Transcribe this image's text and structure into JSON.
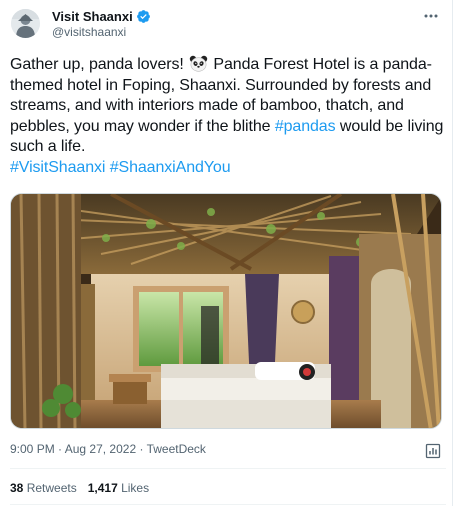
{
  "author": {
    "display_name": "Visit Shaanxi",
    "handle": "@visitshaanxi"
  },
  "tweet": {
    "text_before_link": "Gather up, panda lovers! ",
    "text_after_emoji": " Panda Forest Hotel is a panda-themed hotel in Foping, Shaanxi. Surrounded by forests and streams, and with interiors made of bamboo, thatch, and pebbles, you may wonder if the blithe ",
    "link_pandas": "#pandas",
    "text_after_link": " would be living such a life.",
    "hashtag_1": "#VisitShaanxi",
    "hashtag_2": "#ShaanxiAndYou"
  },
  "meta": {
    "time": "9:00 PM",
    "separator_1": " · ",
    "date": "Aug 27, 2022",
    "separator_2": " · ",
    "source": "TweetDeck"
  },
  "stats": {
    "retweets_count": "38",
    "retweets_label": " Retweets",
    "likes_count": "1,417",
    "likes_label": " Likes"
  },
  "colors": {
    "link": "#1d9bf0",
    "verified": "#1d9bf0",
    "secondary_text": "#536471"
  },
  "icons": {
    "verified": "verified-badge-icon",
    "more": "more-dots-icon",
    "emoji": "panda-face-icon",
    "analytics": "analytics-icon"
  }
}
